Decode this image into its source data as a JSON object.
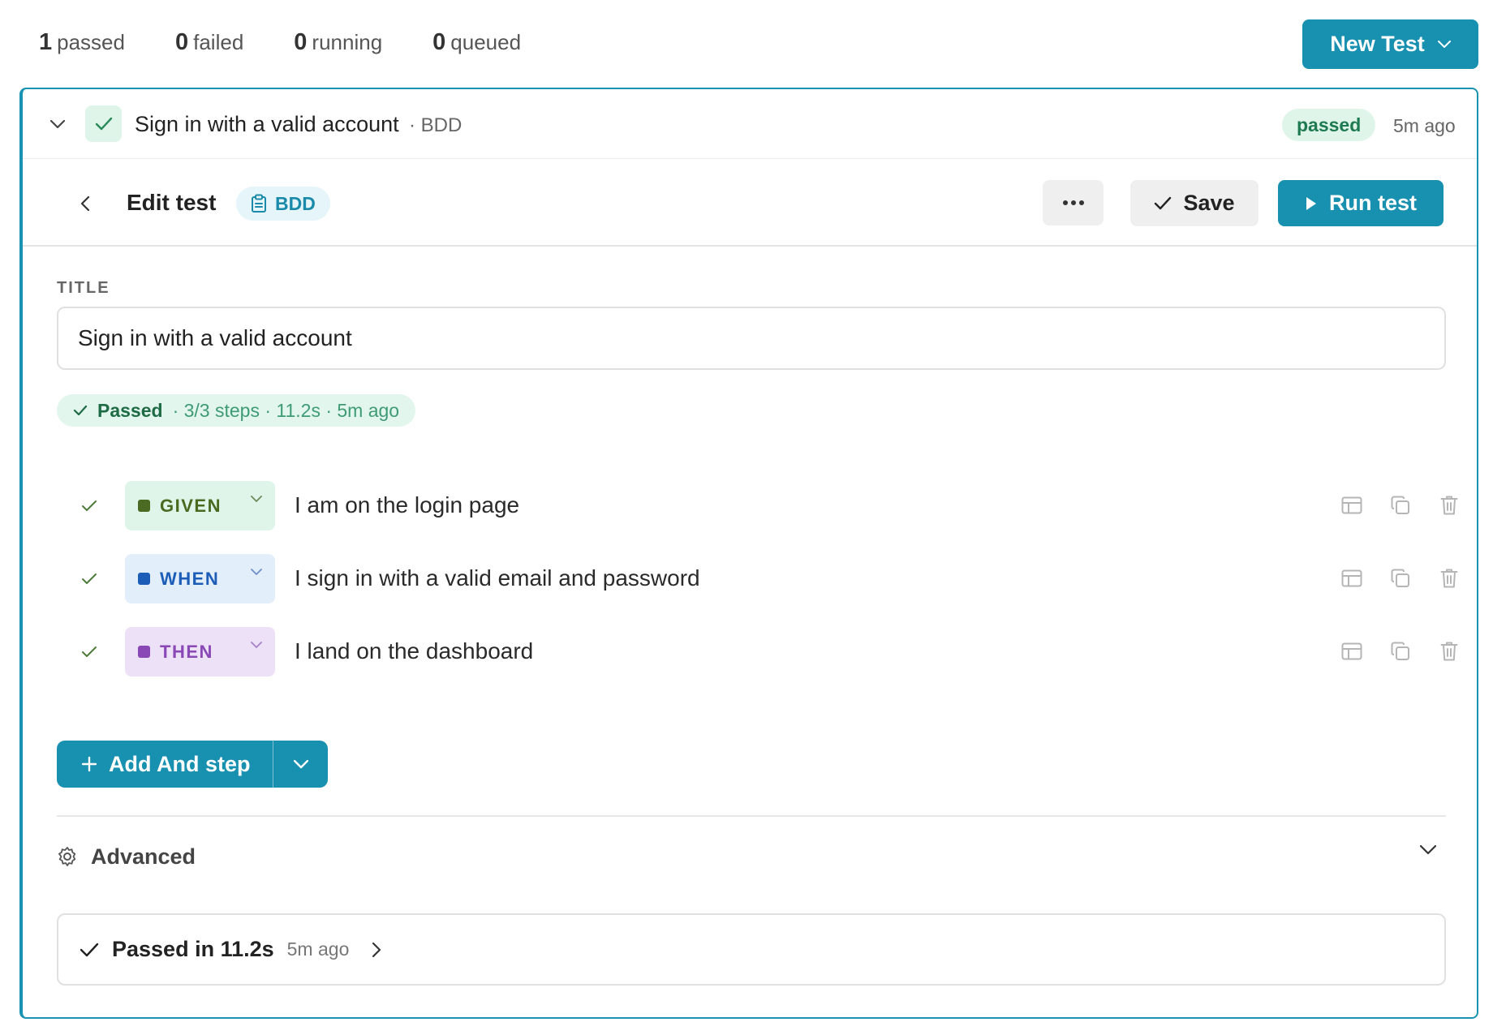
{
  "summary": {
    "passed_count": "1",
    "passed_label": "passed",
    "failed_count": "0",
    "failed_label": "failed",
    "running_count": "0",
    "running_label": "running",
    "queued_count": "0",
    "queued_label": "queued"
  },
  "new_test_label": "New Test",
  "test": {
    "title": "Sign in with a valid account",
    "type_label": "· BDD",
    "status": "passed",
    "time_ago": "5m ago"
  },
  "editor": {
    "heading": "Edit test",
    "mode_badge": "BDD",
    "save_label": "Save",
    "run_label": "Run test",
    "title_label": "TITLE",
    "title_value": "Sign in with a valid account",
    "run_summary": {
      "status": "Passed",
      "meta": "· 3/3 steps · 11.2s · 5m ago"
    },
    "steps": [
      {
        "keyword": "GIVEN",
        "text": "I am on the login page"
      },
      {
        "keyword": "WHEN",
        "text": "I sign in with a valid email and password"
      },
      {
        "keyword": "THEN",
        "text": "I land on the dashboard"
      }
    ],
    "add_step_label": "Add And step",
    "advanced_label": "Advanced",
    "last_run": {
      "label": "Passed in 11.2s",
      "time_ago": "5m ago"
    }
  },
  "colors": {
    "accent": "#1890b0",
    "passed_bg": "#dff5ea",
    "passed_text": "#1e7a50",
    "given": "#4b6a22",
    "when": "#1c5db8",
    "then": "#8a47b6"
  }
}
